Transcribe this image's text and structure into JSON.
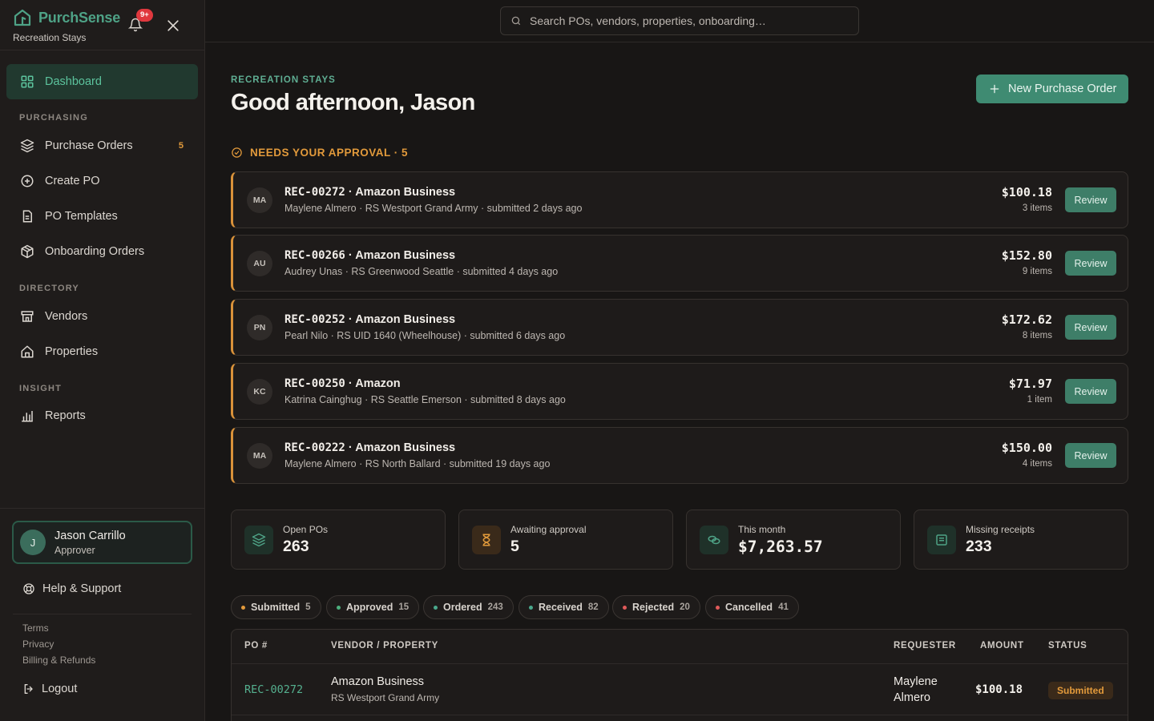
{
  "brand": {
    "name": "PurchSense",
    "org": "Recreation Stays",
    "notifications": "9+"
  },
  "sidebar": {
    "dashboard": "Dashboard",
    "sections": {
      "purchasing": "PURCHASING",
      "directory": "DIRECTORY",
      "insight": "INSIGHT"
    },
    "purchasing_items": [
      {
        "label": "Purchase Orders",
        "count": "5",
        "icon": "layers-icon"
      },
      {
        "label": "Create PO",
        "icon": "plus-circle-icon"
      },
      {
        "label": "PO Templates",
        "icon": "template-icon"
      },
      {
        "label": "Onboarding Orders",
        "icon": "package-icon"
      }
    ],
    "directory_items": [
      {
        "label": "Vendors",
        "icon": "store-icon"
      },
      {
        "label": "Properties",
        "icon": "home-icon"
      }
    ],
    "insight_items": [
      {
        "label": "Reports",
        "icon": "bar-chart-icon"
      }
    ],
    "user": {
      "initial": "J",
      "name": "Jason Carrillo",
      "role": "Approver"
    },
    "help": "Help & Support",
    "footer_links": [
      "Terms",
      "Privacy",
      "Billing & Refunds"
    ],
    "logout": "Logout"
  },
  "search": {
    "placeholder": "Search POs, vendors, properties, onboarding…"
  },
  "header": {
    "kicker": "RECREATION STAYS",
    "greeting": "Good afternoon, Jason",
    "new_po": "New Purchase Order"
  },
  "approvals": {
    "heading": "NEEDS YOUR APPROVAL · 5",
    "review_label": "Review",
    "items": [
      {
        "initials": "MA",
        "po": "REC-00272",
        "vendor": " · Amazon Business",
        "detail": "Maylene Almero · RS Westport Grand Army · submitted 2 days ago",
        "amount": "$100.18",
        "items": "3 items"
      },
      {
        "initials": "AU",
        "po": "REC-00266",
        "vendor": " · Amazon Business",
        "detail": "Audrey Unas · RS Greenwood Seattle · submitted 4 days ago",
        "amount": "$152.80",
        "items": "9 items"
      },
      {
        "initials": "PN",
        "po": "REC-00252",
        "vendor": " · Amazon Business",
        "detail": "Pearl Nilo · RS UID 1640 (Wheelhouse) · submitted 6 days ago",
        "amount": "$172.62",
        "items": "8 items"
      },
      {
        "initials": "KC",
        "po": "REC-00250",
        "vendor": " · Amazon",
        "detail": "Katrina Cainghug · RS Seattle Emerson · submitted 8 days ago",
        "amount": "$71.97",
        "items": "1 item"
      },
      {
        "initials": "MA",
        "po": "REC-00222",
        "vendor": " · Amazon Business",
        "detail": "Maylene Almero · RS North Ballard · submitted 19 days ago",
        "amount": "$150.00",
        "items": "4 items"
      }
    ]
  },
  "stats": [
    {
      "label": "Open POs",
      "value": "263",
      "icon": "layers-icon",
      "color": "#4ea286"
    },
    {
      "label": "Awaiting approval",
      "value": "5",
      "icon": "hourglass-icon",
      "color": "#e29a3b"
    },
    {
      "label": "This month",
      "value": "$7,263.57",
      "icon": "coins-icon",
      "color": "#4ea286"
    },
    {
      "label": "Missing receipts",
      "value": "233",
      "icon": "receipt-icon",
      "color": "#4ea286"
    }
  ],
  "filters": [
    {
      "label": "Submitted",
      "count": "5",
      "color": "#e29a3b"
    },
    {
      "label": "Approved",
      "count": "15",
      "color": "#4caf7d"
    },
    {
      "label": "Ordered",
      "count": "243",
      "color": "#4aa88c"
    },
    {
      "label": "Received",
      "count": "82",
      "color": "#4aa88c"
    },
    {
      "label": "Rejected",
      "count": "20",
      "color": "#e05a5a"
    },
    {
      "label": "Cancelled",
      "count": "41",
      "color": "#e05a5a"
    }
  ],
  "table": {
    "headers": {
      "po": "PO #",
      "vendor": "VENDOR / PROPERTY",
      "requester": "REQUESTER",
      "amount": "AMOUNT",
      "status": "STATUS"
    },
    "rows": [
      {
        "po": "REC-00272",
        "vendor": "Amazon Business",
        "property": "RS Westport Grand Army",
        "requester": "Maylene Almero",
        "amount": "$100.18",
        "status": "Submitted"
      }
    ]
  },
  "colors": {
    "accent": "#3f8b72",
    "warning": "#e29a3b",
    "background": "#181615"
  }
}
